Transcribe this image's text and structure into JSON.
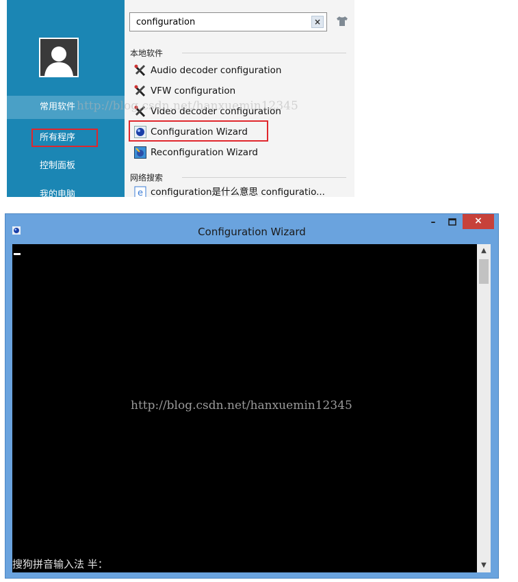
{
  "start_menu": {
    "nav": [
      {
        "label": "常用软件",
        "active": true
      },
      {
        "label": "所有程序",
        "active": false
      },
      {
        "label": "控制面板",
        "active": false
      },
      {
        "label": "我的电脑",
        "active": false
      }
    ],
    "search": {
      "value": "configuration",
      "clear_label": "×"
    },
    "sections": {
      "local": "本地软件",
      "web": "网络搜索"
    },
    "results": [
      {
        "label": "Audio decoder configuration",
        "icon": "tools-icon"
      },
      {
        "label": "VFW configuration",
        "icon": "tools-icon"
      },
      {
        "label": "Video decoder configuration",
        "icon": "tools-icon"
      },
      {
        "label": "Configuration Wizard",
        "icon": "blue-orb-icon"
      },
      {
        "label": "Reconfiguration Wizard",
        "icon": "wizard-icon"
      }
    ],
    "web_result": {
      "label": "configuration是什么意思 configuratio...",
      "icon": "ie-icon"
    },
    "watermark": "http://blog.csdn.net/hanxuemin12345"
  },
  "console": {
    "title": "Configuration Wizard",
    "minimize_label": "–",
    "close_label": "×",
    "watermark": "http://blog.csdn.net/hanxuemin12345",
    "ime_status": "搜狗拼音输入法 半：",
    "scroll_up": "▲",
    "scroll_down": "▼"
  },
  "colors": {
    "sidebar": "#1b86b4",
    "highlight_border": "#e0262c",
    "console_frame": "#6aa3de",
    "close_button": "#c7413a"
  }
}
